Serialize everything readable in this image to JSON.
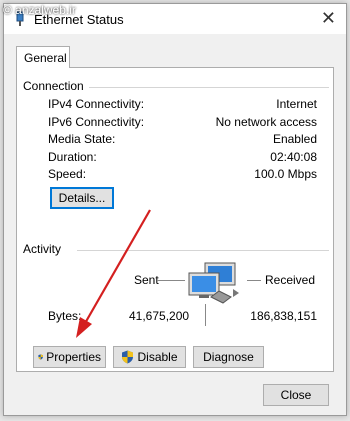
{
  "watermark": "© anzalweb.ir",
  "window": {
    "title": "Ethernet Status"
  },
  "tabs": [
    {
      "label": "General"
    }
  ],
  "connection": {
    "heading": "Connection",
    "rows": [
      {
        "label": "IPv4 Connectivity:",
        "value": "Internet"
      },
      {
        "label": "IPv6 Connectivity:",
        "value": "No network access"
      },
      {
        "label": "Media State:",
        "value": "Enabled"
      },
      {
        "label": "Duration:",
        "value": "02:40:08"
      },
      {
        "label": "Speed:",
        "value": "100.0 Mbps"
      }
    ],
    "details_button": "Details..."
  },
  "activity": {
    "heading": "Activity",
    "sent_label": "Sent",
    "received_label": "Received",
    "bytes_label": "Bytes:",
    "bytes_sent": "41,675,200",
    "bytes_received": "186,838,151"
  },
  "buttons": {
    "properties": "Properties",
    "disable": "Disable",
    "diagnose": "Diagnose",
    "close": "Close"
  },
  "colors": {
    "accent": "#0078d7",
    "annotation_arrow": "#d42020"
  },
  "icons": {
    "network": "network-computers-icon",
    "shield": "uac-shield-icon"
  }
}
